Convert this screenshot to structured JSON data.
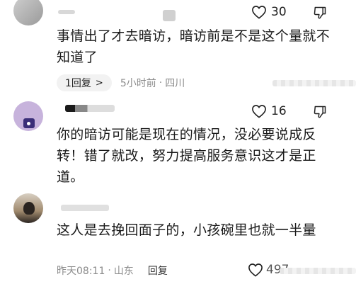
{
  "comments": [
    {
      "likes": "30",
      "text": "事情出了才去暗访，暗访前是不是这个量就不知道了",
      "reply_count_label": "1回复",
      "reply_chevron": ">",
      "time": "5小时前",
      "separator": "·",
      "location": "四川"
    },
    {
      "likes": "16",
      "text": "你的暗访可能是现在的情况，没必要说成反转！错了就改，努力提高服务意识这才是正道。"
    },
    {
      "likes": "497",
      "text": "这人是去挽回面子的，小孩碗里也就一半量",
      "time": "昨天08:11",
      "separator": "·",
      "location": "山东",
      "reply_label": "回复"
    }
  ],
  "icons": {
    "like": "heart-outline-icon",
    "dislike": "thumbs-down-outline-icon"
  }
}
